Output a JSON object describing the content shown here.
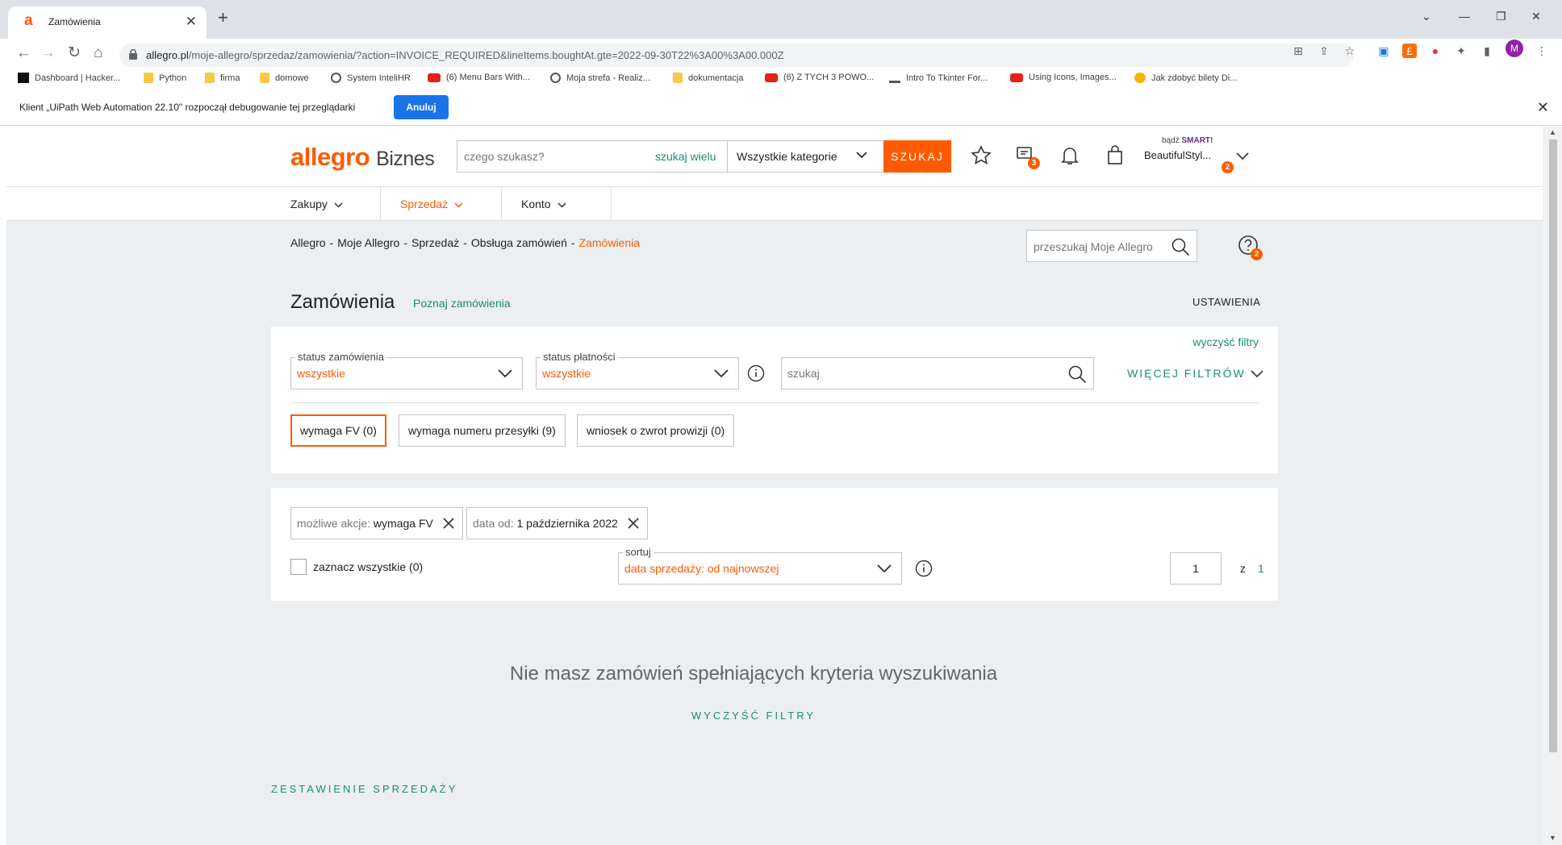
{
  "browser": {
    "tab_title": "Zamówienia",
    "tab_favicon": "a",
    "url_host": "allegro.pl",
    "url_path": "/moje-allegro/sprzedaz/zamowienia/?action=INVOICE_REQUIRED&lineItems.boughtAt.gte=2022-09-30T22%3A00%3A00.000Z",
    "profile_initial": "M",
    "bookmarks": [
      {
        "label": "Dashboard | Hacker...",
        "icon": "hackerrank-icon"
      },
      {
        "label": "Python",
        "icon": "folder-icon"
      },
      {
        "label": "firma",
        "icon": "folder-icon"
      },
      {
        "label": "domowe",
        "icon": "folder-icon"
      },
      {
        "label": "System InteliHR",
        "icon": "globe-icon"
      },
      {
        "label": "(6) Menu Bars With...",
        "icon": "youtube-icon"
      },
      {
        "label": "Moja strefa - Realiz...",
        "icon": "globe-icon"
      },
      {
        "label": "dokumentacja",
        "icon": "folder-icon"
      },
      {
        "label": "(6) Z TYCH 3 POWO...",
        "icon": "youtube-icon"
      },
      {
        "label": "Intro To Tkinter For...",
        "icon": "cap-icon"
      },
      {
        "label": "Using Icons, Images...",
        "icon": "youtube-icon"
      },
      {
        "label": "Jak zdobyć bilety Di...",
        "icon": "coin-icon"
      }
    ],
    "debug_message": "Klient „UiPath Web Automation 22.10\" rozpoczął debugowanie tej przeglądarki",
    "debug_cancel": "Anuluj"
  },
  "header": {
    "logo_main": "allegro",
    "logo_sub": "Biznes",
    "search_placeholder": "czego szukasz?",
    "search_many": "szukaj wielu",
    "category": "Wszystkie kategorie",
    "search_button": "SZUKAJ",
    "messages_badge": "3",
    "smart_prefix": "bądź",
    "smart_label": "SMART!",
    "account_name": "BeautifulStyl...",
    "account_badge": "2"
  },
  "menu": {
    "items": [
      "Zakupy",
      "Sprzedaż",
      "Konto"
    ]
  },
  "breadcrumbs": [
    "Allegro",
    "Moje Allegro",
    "Sprzedaż",
    "Obsługa zamówień",
    "Zamówienia"
  ],
  "myallegro_search_placeholder": "przeszukaj Moje Allegro",
  "help_badge": "2",
  "page": {
    "title": "Zamówienia",
    "learn_link": "Poznaj zamówienia",
    "settings": "USTAWIENIA"
  },
  "filters": {
    "clear": "wyczyść filtry",
    "order_status_label": "status zamówienia",
    "order_status_value": "wszystkie",
    "payment_status_label": "status płatności",
    "payment_status_value": "wszystkie",
    "search_placeholder": "szukaj",
    "more_filters": "WIĘCEJ FILTRÓW",
    "chips": [
      "wymaga FV (0)",
      "wymaga numeru przesyłki (9)",
      "wniosek o zwrot prowizji (0)"
    ]
  },
  "active_filters": {
    "tag1_prefix": "możliwe akcje:",
    "tag1_value": "wymaga FV",
    "tag2_prefix": "data od:",
    "tag2_value": "1 października 2022",
    "select_all": "zaznacz wszystkie (0)",
    "sort_label": "sortuj",
    "sort_value": "data sprzedaży: od najnowszej",
    "page_current": "1",
    "page_of": "z",
    "page_total": "1"
  },
  "empty_state": {
    "message": "Nie masz zamówień spełniających kryteria wyszukiwania",
    "clear": "WYCZYŚĆ FILTRY"
  },
  "footer_link": "ZESTAWIENIE SPRZEDAŻY",
  "colors": {
    "brand": "#ff5a00",
    "link": "#1a8e76",
    "background": "#eceff1"
  }
}
